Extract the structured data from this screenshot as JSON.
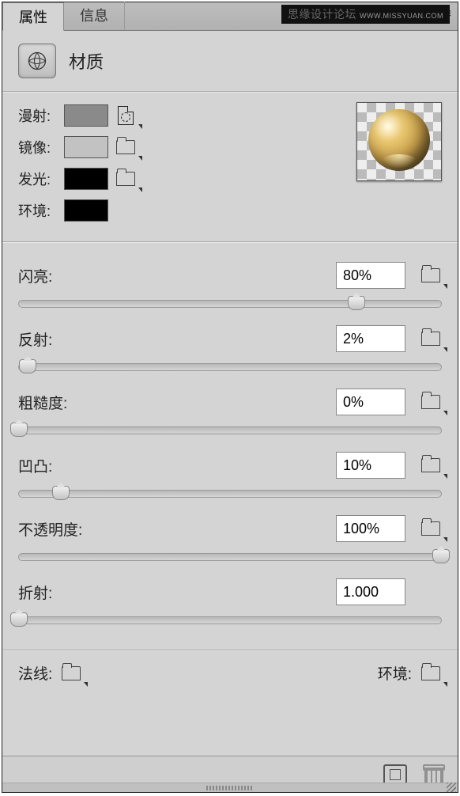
{
  "watermark": {
    "text": "思缘设计论坛",
    "url": "WWW.MISSYUAN.COM"
  },
  "tabs": {
    "properties": "属性",
    "info": "信息"
  },
  "header": {
    "title": "材质"
  },
  "colors": {
    "diffuse": {
      "label": "漫射:",
      "hex": "#8a8a8a"
    },
    "specular": {
      "label": "镜像:",
      "hex": "#c2c2c2"
    },
    "illumination": {
      "label": "发光:",
      "hex": "#000000"
    },
    "ambient": {
      "label": "环境:",
      "hex": "#000000"
    }
  },
  "sliders": {
    "shine": {
      "label": "闪亮:",
      "value": "80%",
      "pos": 80
    },
    "reflection": {
      "label": "反射:",
      "value": "2%",
      "pos": 2
    },
    "roughness": {
      "label": "粗糙度:",
      "value": "0%",
      "pos": 0
    },
    "bump": {
      "label": "凹凸:",
      "value": "10%",
      "pos": 10
    },
    "opacity": {
      "label": "不透明度:",
      "value": "100%",
      "pos": 100
    },
    "refraction": {
      "label": "折射:",
      "value": "1.000",
      "pos": 0
    }
  },
  "bottom": {
    "normal": "法线:",
    "environment": "环境:"
  }
}
